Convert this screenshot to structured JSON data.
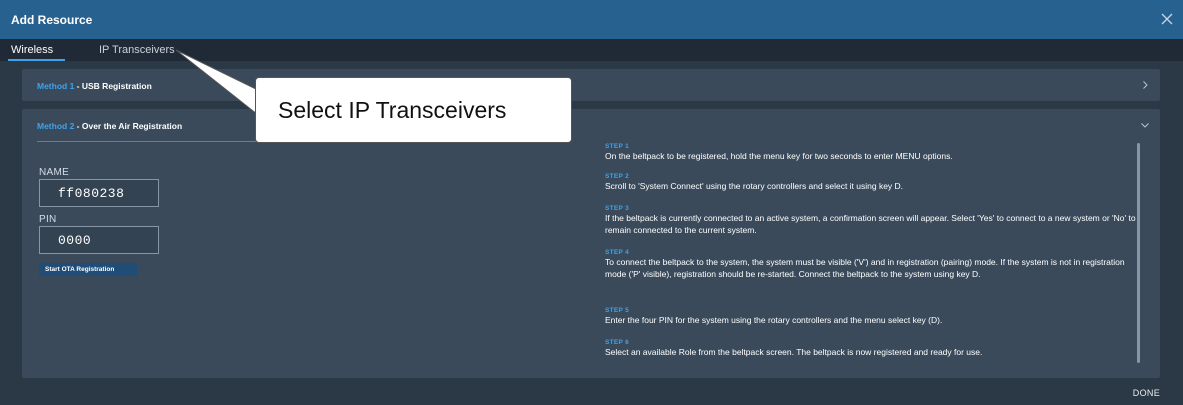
{
  "dialog": {
    "title": "Add Resource",
    "done_label": "DONE"
  },
  "tabs": [
    {
      "label": "Wireless",
      "active": true
    },
    {
      "label": "IP Transceivers",
      "active": false
    }
  ],
  "method1": {
    "prefix": "Method 1",
    "title": " - USB Registration",
    "expanded": false
  },
  "method2": {
    "prefix": "Method 2",
    "title": " - Over the Air Registration",
    "expanded": true,
    "name_label": "NAME",
    "name_value": "ff080238",
    "pin_label": "PIN",
    "pin_value": "0000",
    "start_button": "Start OTA Registration",
    "steps": [
      {
        "head": "STEP 1",
        "text": "On the beltpack to be registered, hold the menu key for two seconds to enter MENU options."
      },
      {
        "head": "STEP 2",
        "text": "Scroll to 'System Connect' using the rotary controllers and select it using key D."
      },
      {
        "head": "STEP 3",
        "text": "If the beltpack is currently connected to an active system, a confirmation screen will appear. Select 'Yes' to connect to a new system or 'No' to remain connected to the current system."
      },
      {
        "head": "STEP 4",
        "text": "To connect the beltpack to the system, the system must be visible ('V') and in registration (pairing) mode. If the system is not in registration mode ('P' visible), registration should be re-started. Connect the beltpack to the system using key D."
      },
      {
        "head": "STEP 5",
        "text": "Enter the four PIN for the system using the rotary controllers and the menu select key (D)."
      },
      {
        "head": "STEP 6",
        "text": "Select an available Role from the beltpack screen. The beltpack is now registered and ready for use."
      }
    ]
  },
  "callout": {
    "text": "Select IP Transceivers"
  },
  "colors": {
    "titlebar": "#27618f",
    "accent": "#3fa2ea",
    "background": "#2b3846",
    "panel": "#3a4a5b"
  },
  "icons": [
    "close-icon",
    "chevron-right-icon",
    "chevron-down-icon"
  ]
}
